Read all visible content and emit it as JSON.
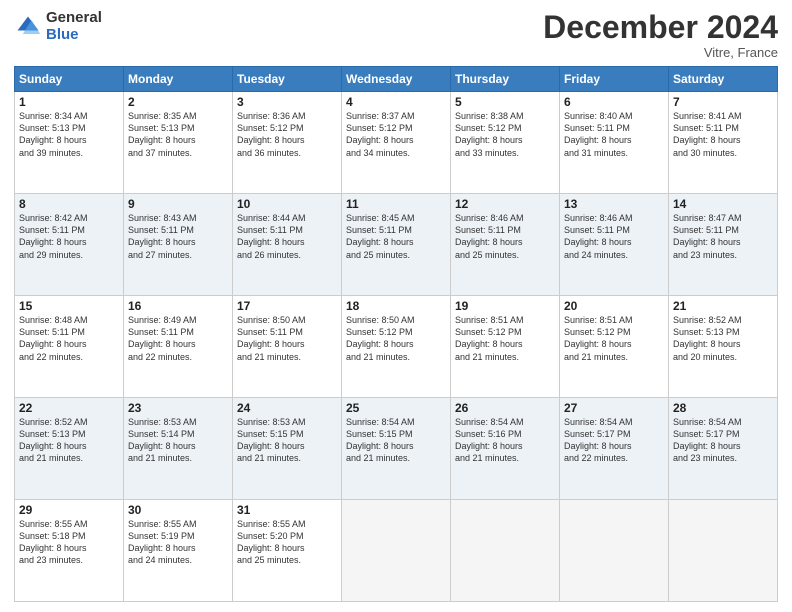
{
  "logo": {
    "general": "General",
    "blue": "Blue"
  },
  "header": {
    "month": "December 2024",
    "location": "Vitre, France"
  },
  "weekdays": [
    "Sunday",
    "Monday",
    "Tuesday",
    "Wednesday",
    "Thursday",
    "Friday",
    "Saturday"
  ],
  "weeks": [
    [
      {
        "day": "1",
        "lines": [
          "Sunrise: 8:34 AM",
          "Sunset: 5:13 PM",
          "Daylight: 8 hours",
          "and 39 minutes."
        ]
      },
      {
        "day": "2",
        "lines": [
          "Sunrise: 8:35 AM",
          "Sunset: 5:13 PM",
          "Daylight: 8 hours",
          "and 37 minutes."
        ]
      },
      {
        "day": "3",
        "lines": [
          "Sunrise: 8:36 AM",
          "Sunset: 5:12 PM",
          "Daylight: 8 hours",
          "and 36 minutes."
        ]
      },
      {
        "day": "4",
        "lines": [
          "Sunrise: 8:37 AM",
          "Sunset: 5:12 PM",
          "Daylight: 8 hours",
          "and 34 minutes."
        ]
      },
      {
        "day": "5",
        "lines": [
          "Sunrise: 8:38 AM",
          "Sunset: 5:12 PM",
          "Daylight: 8 hours",
          "and 33 minutes."
        ]
      },
      {
        "day": "6",
        "lines": [
          "Sunrise: 8:40 AM",
          "Sunset: 5:11 PM",
          "Daylight: 8 hours",
          "and 31 minutes."
        ]
      },
      {
        "day": "7",
        "lines": [
          "Sunrise: 8:41 AM",
          "Sunset: 5:11 PM",
          "Daylight: 8 hours",
          "and 30 minutes."
        ]
      }
    ],
    [
      {
        "day": "8",
        "lines": [
          "Sunrise: 8:42 AM",
          "Sunset: 5:11 PM",
          "Daylight: 8 hours",
          "and 29 minutes."
        ]
      },
      {
        "day": "9",
        "lines": [
          "Sunrise: 8:43 AM",
          "Sunset: 5:11 PM",
          "Daylight: 8 hours",
          "and 27 minutes."
        ]
      },
      {
        "day": "10",
        "lines": [
          "Sunrise: 8:44 AM",
          "Sunset: 5:11 PM",
          "Daylight: 8 hours",
          "and 26 minutes."
        ]
      },
      {
        "day": "11",
        "lines": [
          "Sunrise: 8:45 AM",
          "Sunset: 5:11 PM",
          "Daylight: 8 hours",
          "and 25 minutes."
        ]
      },
      {
        "day": "12",
        "lines": [
          "Sunrise: 8:46 AM",
          "Sunset: 5:11 PM",
          "Daylight: 8 hours",
          "and 25 minutes."
        ]
      },
      {
        "day": "13",
        "lines": [
          "Sunrise: 8:46 AM",
          "Sunset: 5:11 PM",
          "Daylight: 8 hours",
          "and 24 minutes."
        ]
      },
      {
        "day": "14",
        "lines": [
          "Sunrise: 8:47 AM",
          "Sunset: 5:11 PM",
          "Daylight: 8 hours",
          "and 23 minutes."
        ]
      }
    ],
    [
      {
        "day": "15",
        "lines": [
          "Sunrise: 8:48 AM",
          "Sunset: 5:11 PM",
          "Daylight: 8 hours",
          "and 22 minutes."
        ]
      },
      {
        "day": "16",
        "lines": [
          "Sunrise: 8:49 AM",
          "Sunset: 5:11 PM",
          "Daylight: 8 hours",
          "and 22 minutes."
        ]
      },
      {
        "day": "17",
        "lines": [
          "Sunrise: 8:50 AM",
          "Sunset: 5:11 PM",
          "Daylight: 8 hours",
          "and 21 minutes."
        ]
      },
      {
        "day": "18",
        "lines": [
          "Sunrise: 8:50 AM",
          "Sunset: 5:12 PM",
          "Daylight: 8 hours",
          "and 21 minutes."
        ]
      },
      {
        "day": "19",
        "lines": [
          "Sunrise: 8:51 AM",
          "Sunset: 5:12 PM",
          "Daylight: 8 hours",
          "and 21 minutes."
        ]
      },
      {
        "day": "20",
        "lines": [
          "Sunrise: 8:51 AM",
          "Sunset: 5:12 PM",
          "Daylight: 8 hours",
          "and 21 minutes."
        ]
      },
      {
        "day": "21",
        "lines": [
          "Sunrise: 8:52 AM",
          "Sunset: 5:13 PM",
          "Daylight: 8 hours",
          "and 20 minutes."
        ]
      }
    ],
    [
      {
        "day": "22",
        "lines": [
          "Sunrise: 8:52 AM",
          "Sunset: 5:13 PM",
          "Daylight: 8 hours",
          "and 21 minutes."
        ]
      },
      {
        "day": "23",
        "lines": [
          "Sunrise: 8:53 AM",
          "Sunset: 5:14 PM",
          "Daylight: 8 hours",
          "and 21 minutes."
        ]
      },
      {
        "day": "24",
        "lines": [
          "Sunrise: 8:53 AM",
          "Sunset: 5:15 PM",
          "Daylight: 8 hours",
          "and 21 minutes."
        ]
      },
      {
        "day": "25",
        "lines": [
          "Sunrise: 8:54 AM",
          "Sunset: 5:15 PM",
          "Daylight: 8 hours",
          "and 21 minutes."
        ]
      },
      {
        "day": "26",
        "lines": [
          "Sunrise: 8:54 AM",
          "Sunset: 5:16 PM",
          "Daylight: 8 hours",
          "and 21 minutes."
        ]
      },
      {
        "day": "27",
        "lines": [
          "Sunrise: 8:54 AM",
          "Sunset: 5:17 PM",
          "Daylight: 8 hours",
          "and 22 minutes."
        ]
      },
      {
        "day": "28",
        "lines": [
          "Sunrise: 8:54 AM",
          "Sunset: 5:17 PM",
          "Daylight: 8 hours",
          "and 23 minutes."
        ]
      }
    ],
    [
      {
        "day": "29",
        "lines": [
          "Sunrise: 8:55 AM",
          "Sunset: 5:18 PM",
          "Daylight: 8 hours",
          "and 23 minutes."
        ]
      },
      {
        "day": "30",
        "lines": [
          "Sunrise: 8:55 AM",
          "Sunset: 5:19 PM",
          "Daylight: 8 hours",
          "and 24 minutes."
        ]
      },
      {
        "day": "31",
        "lines": [
          "Sunrise: 8:55 AM",
          "Sunset: 5:20 PM",
          "Daylight: 8 hours",
          "and 25 minutes."
        ]
      },
      null,
      null,
      null,
      null
    ]
  ]
}
